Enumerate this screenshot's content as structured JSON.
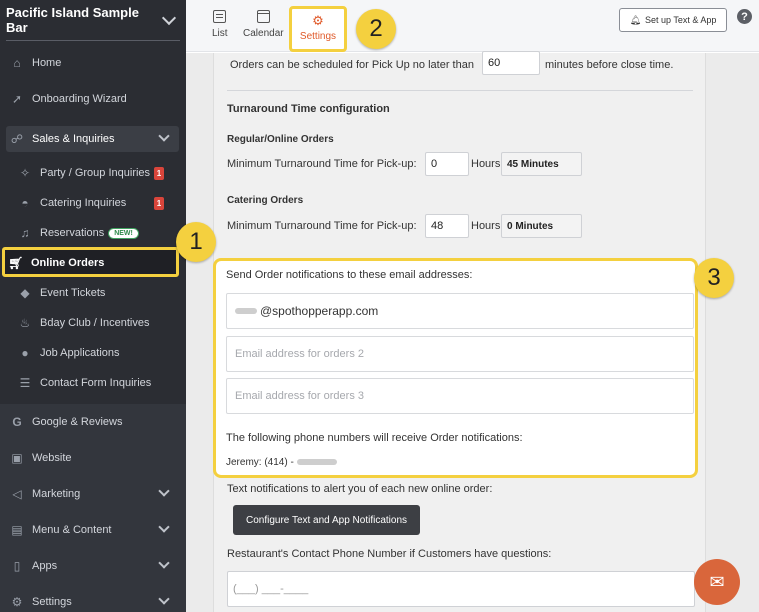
{
  "sidebar": {
    "title": "Pacific Island Sample Bar",
    "items": [
      {
        "label": "Home",
        "icon": "home-icon"
      },
      {
        "label": "Onboarding Wizard",
        "icon": "rocket-icon"
      },
      {
        "label": "Sales & Inquiries",
        "icon": "chat-icon"
      },
      {
        "label": "Party / Group Inquiries",
        "icon": "party-icon",
        "badge": "1"
      },
      {
        "label": "Catering Inquiries",
        "icon": "catering-icon",
        "badge": "1"
      },
      {
        "label": "Reservations",
        "icon": "bell-icon",
        "tag": "NEW!"
      },
      {
        "label": "Online Orders",
        "icon": "cart-icon"
      },
      {
        "label": "Event Tickets",
        "icon": "ticket-icon"
      },
      {
        "label": "Bday Club / Incentives",
        "icon": "cake-icon"
      },
      {
        "label": "Job Applications",
        "icon": "user-icon"
      },
      {
        "label": "Contact Form Inquiries",
        "icon": "form-icon"
      },
      {
        "label": "Google & Reviews",
        "icon": "google-icon"
      },
      {
        "label": "Website",
        "icon": "globe-icon"
      },
      {
        "label": "Marketing",
        "icon": "megaphone-icon"
      },
      {
        "label": "Menu & Content",
        "icon": "menu-icon"
      },
      {
        "label": "Apps",
        "icon": "phone-icon"
      },
      {
        "label": "Settings",
        "icon": "gear-icon"
      }
    ]
  },
  "topbar": {
    "tabs": {
      "list": "List",
      "calendar": "Calendar",
      "settings": "Settings"
    },
    "setup_button": "Set up Text & App",
    "help": "?"
  },
  "callouts": {
    "one": "1",
    "two": "2",
    "three": "3"
  },
  "content": {
    "pickup_prefix": "Orders can be scheduled for Pick Up no later than",
    "pickup_value": "60",
    "pickup_suffix": "minutes before close time.",
    "turnaround_heading": "Turnaround Time configuration",
    "regular_heading": "Regular/Online Orders",
    "regular_label": "Minimum Turnaround Time for Pick-up:",
    "regular_value": "0",
    "regular_unit": "Hours",
    "regular_minutes": "45 Minutes",
    "catering_heading": "Catering Orders",
    "catering_label": "Minimum Turnaround Time for Pick-up:",
    "catering_value": "48",
    "catering_unit": "Hours",
    "catering_minutes": "0 Minutes",
    "email_heading": "Send Order notifications to these email addresses:",
    "email1": "@spothopperapp.com",
    "email2_placeholder": "Email address for orders 2",
    "email3_placeholder": "Email address for orders 3",
    "phone_heading": "The following phone numbers will receive Order notifications:",
    "phone_entry": "Jeremy: (414) -",
    "text_notif_label": "Text notifications to alert you of each new online order:",
    "configure_button": "Configure Text and App Notifications",
    "contact_label": "Restaurant's Contact Phone Number if Customers have questions:",
    "contact_placeholder": "(___) ___-____"
  }
}
